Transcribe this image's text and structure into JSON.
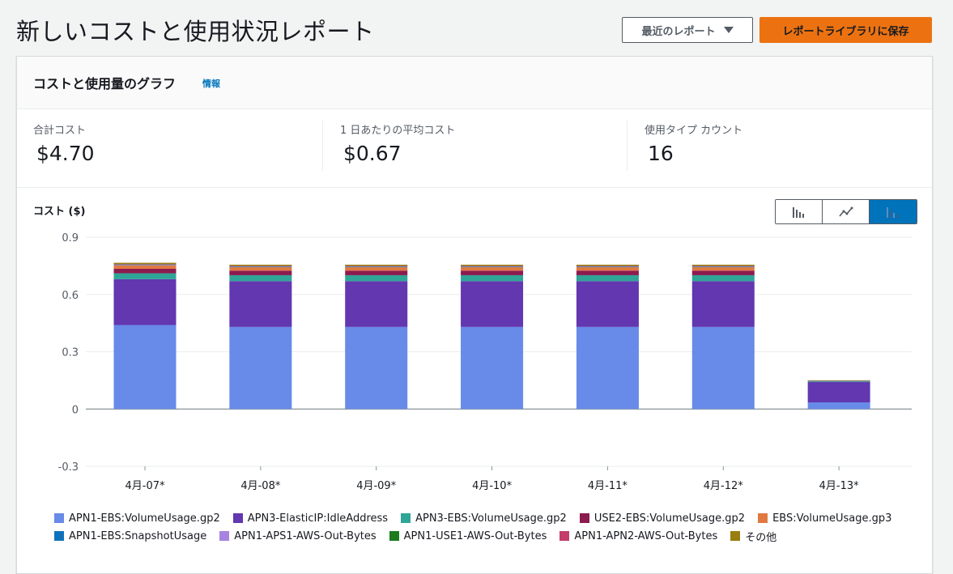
{
  "header": {
    "title": "新しいコストと使用状況レポート",
    "recent_reports_label": "最近のレポート",
    "save_label": "レポートライブラリに保存"
  },
  "panel": {
    "title": "コストと使用量のグラフ",
    "info_link": "情報"
  },
  "kpis": [
    {
      "label": "合計コスト",
      "value": "$4.70"
    },
    {
      "label": "1 日あたりの平均コスト",
      "value": "$0.67"
    },
    {
      "label": "使用タイプ カウント",
      "value": "16"
    }
  ],
  "chart_toggle": {
    "options": [
      "bar-chart-icon",
      "line-chart-icon",
      "stacked-bar-chart-icon"
    ],
    "active": "stacked-bar-chart-icon"
  },
  "chart_data": {
    "type": "bar",
    "stacked": true,
    "ylabel": "コスト ($)",
    "ylim": [
      -0.3,
      0.9
    ],
    "yticks": [
      "0.9",
      "0.6",
      "0.3",
      "0",
      "-0.3"
    ],
    "grid": true,
    "categories": [
      "4月-07*",
      "4月-08*",
      "4月-09*",
      "4月-10*",
      "4月-11*",
      "4月-12*",
      "4月-13*"
    ],
    "series": [
      {
        "name": "APN1-EBS:VolumeUsage.gp2",
        "color": "#688ae8",
        "values": [
          0.44,
          0.43,
          0.43,
          0.43,
          0.43,
          0.43,
          0.035
        ]
      },
      {
        "name": "APN3-ElasticIP:IdleAddress",
        "color": "#6237b0",
        "values": [
          0.24,
          0.24,
          0.24,
          0.24,
          0.24,
          0.24,
          0.107
        ]
      },
      {
        "name": "APN3-EBS:VolumeUsage.gp2",
        "color": "#2ea597",
        "values": [
          0.031,
          0.031,
          0.031,
          0.031,
          0.031,
          0.031,
          0.003
        ]
      },
      {
        "name": "USE2-EBS:VolumeUsage.gp2",
        "color": "#8c1b4e",
        "values": [
          0.024,
          0.024,
          0.024,
          0.024,
          0.024,
          0.024,
          0.002
        ]
      },
      {
        "name": "EBS:VolumeUsage.gp3",
        "color": "#e07941",
        "values": [
          0.018,
          0.018,
          0.018,
          0.018,
          0.018,
          0.018,
          0.001
        ]
      },
      {
        "name": "APN1-EBS:SnapshotUsage",
        "color": "#0f73bb",
        "values": [
          0.002,
          0.002,
          0.002,
          0.002,
          0.002,
          0.002,
          0.0005
        ]
      },
      {
        "name": "APN1-APS1-AWS-Out-Bytes",
        "color": "#a783e1",
        "values": [
          0.002,
          0.002,
          0.002,
          0.002,
          0.002,
          0.002,
          0
        ]
      },
      {
        "name": "APN1-USE1-AWS-Out-Bytes",
        "color": "#1d7a1d",
        "values": [
          0.002,
          0.002,
          0.002,
          0.002,
          0.002,
          0.002,
          0
        ]
      },
      {
        "name": "APN1-APN2-AWS-Out-Bytes",
        "color": "#c33d69",
        "values": [
          0.001,
          0.001,
          0.001,
          0.001,
          0.001,
          0.001,
          0
        ]
      },
      {
        "name": "その他",
        "color": "#987d0f",
        "values": [
          0.006,
          0.006,
          0.006,
          0.006,
          0.006,
          0.006,
          0.002
        ]
      }
    ],
    "legend_position": "bottom"
  }
}
